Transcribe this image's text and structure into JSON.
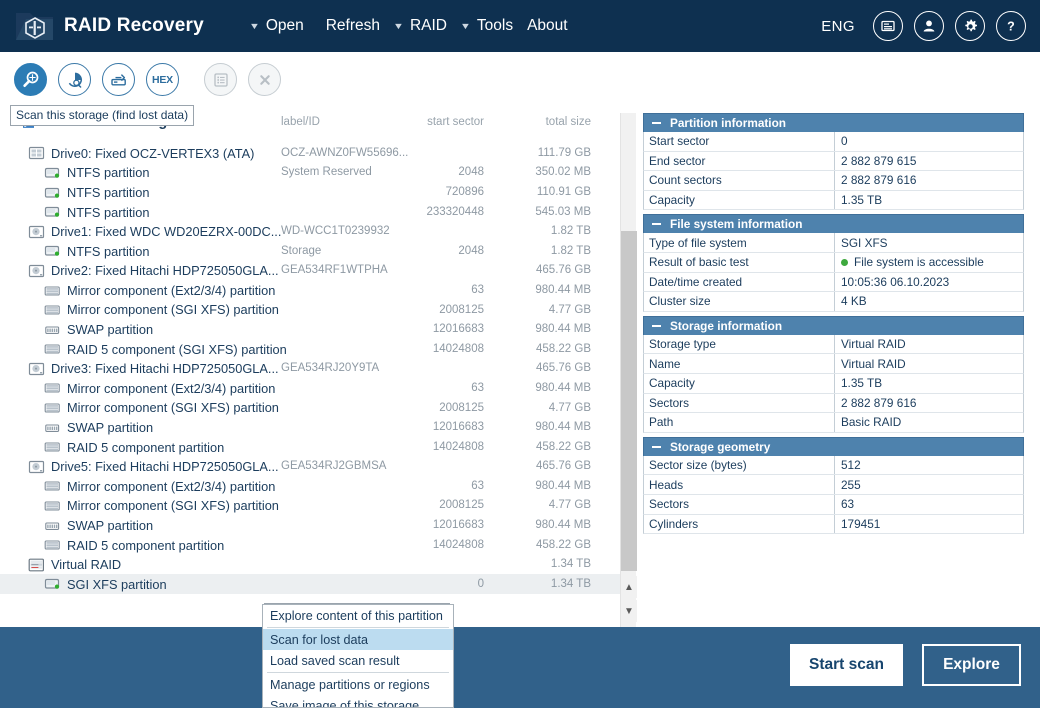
{
  "header": {
    "app_title": "RAID Recovery",
    "logo_icon": "raid-folder-logo",
    "menus": [
      {
        "label": "Open",
        "caret": "▼"
      },
      {
        "label": "Refresh",
        "caret": "▼"
      },
      {
        "label": "RAID",
        "caret": "▼"
      },
      {
        "label": "Tools",
        "caret": "▼"
      },
      {
        "label": "About",
        "caret": ""
      }
    ],
    "language": "ENG",
    "icons": [
      "news-icon",
      "user-icon",
      "gear-icon",
      "help-icon"
    ]
  },
  "toolbar": {
    "buttons": [
      {
        "name": "scan-this-storage",
        "icon": "magnifier-scan-icon",
        "state": "active"
      },
      {
        "name": "disk-analysis",
        "icon": "pie-disk-icon",
        "state": "normal"
      },
      {
        "name": "save-image",
        "icon": "disk-image-icon",
        "state": "normal"
      },
      {
        "name": "hex-viewer",
        "icon": "hex-icon",
        "state": "normal",
        "label": "HEX"
      },
      {
        "name": "list-view",
        "icon": "list-icon",
        "state": "disabled"
      },
      {
        "name": "close-view",
        "icon": "close-x-icon",
        "state": "disabled"
      }
    ],
    "tooltip": "Scan this storage (find lost data)"
  },
  "tree": {
    "title": "Connected storages",
    "title_icon": "connected-storages-icon",
    "columns": {
      "label": "label/ID",
      "start": "start sector",
      "total": "total size"
    },
    "rows": [
      {
        "kind": "drive",
        "icon": "ssd-icon",
        "name": "Drive0: Fixed OCZ-VERTEX3 (ATA)",
        "label": "OCZ-AWNZ0FW55696...",
        "start": "",
        "total": "111.79 GB"
      },
      {
        "kind": "part",
        "icon": "partition-icon",
        "name": "NTFS partition",
        "label": "System Reserved",
        "start": "2048",
        "total": "350.02 MB"
      },
      {
        "kind": "part",
        "icon": "partition-icon",
        "name": "NTFS partition",
        "label": "",
        "start": "720896",
        "total": "110.91 GB"
      },
      {
        "kind": "part",
        "icon": "partition-icon",
        "name": "NTFS partition",
        "label": "",
        "start": "233320448",
        "total": "545.03 MB"
      },
      {
        "kind": "drive",
        "icon": "hdd-icon",
        "name": "Drive1: Fixed WDC WD20EZRX-00DC...",
        "label": "WD-WCC1T0239932",
        "start": "",
        "total": "1.82 TB"
      },
      {
        "kind": "part",
        "icon": "partition-icon",
        "name": "NTFS partition",
        "label": "Storage",
        "start": "2048",
        "total": "1.82 TB"
      },
      {
        "kind": "drive",
        "icon": "hdd-icon",
        "name": "Drive2: Fixed Hitachi HDP725050GLA...",
        "label": "GEA534RF1WTPHA",
        "start": "",
        "total": "465.76 GB"
      },
      {
        "kind": "part",
        "icon": "raid-comp-icon",
        "name": "Mirror component (Ext2/3/4) partition",
        "label": "",
        "start": "63",
        "total": "980.44 MB"
      },
      {
        "kind": "part",
        "icon": "raid-comp-icon",
        "name": "Mirror component (SGI XFS) partition",
        "label": "",
        "start": "2008125",
        "total": "4.77 GB"
      },
      {
        "kind": "part",
        "icon": "swap-icon",
        "name": "SWAP partition",
        "label": "",
        "start": "12016683",
        "total": "980.44 MB"
      },
      {
        "kind": "part",
        "icon": "raid-comp-icon",
        "name": "RAID 5 component (SGI XFS) partition",
        "label": "",
        "start": "14024808",
        "total": "458.22 GB"
      },
      {
        "kind": "drive",
        "icon": "hdd-icon",
        "name": "Drive3: Fixed Hitachi HDP725050GLA...",
        "label": "GEA534RJ20Y9TA",
        "start": "",
        "total": "465.76 GB"
      },
      {
        "kind": "part",
        "icon": "raid-comp-icon",
        "name": "Mirror component (Ext2/3/4) partition",
        "label": "",
        "start": "63",
        "total": "980.44 MB"
      },
      {
        "kind": "part",
        "icon": "raid-comp-icon",
        "name": "Mirror component (SGI XFS) partition",
        "label": "",
        "start": "2008125",
        "total": "4.77 GB"
      },
      {
        "kind": "part",
        "icon": "swap-icon",
        "name": "SWAP partition",
        "label": "",
        "start": "12016683",
        "total": "980.44 MB"
      },
      {
        "kind": "part",
        "icon": "raid-comp-icon",
        "name": "RAID 5 component partition",
        "label": "",
        "start": "14024808",
        "total": "458.22 GB"
      },
      {
        "kind": "drive",
        "icon": "hdd-icon",
        "name": "Drive5: Fixed Hitachi HDP725050GLA...",
        "label": "GEA534RJ2GBMSA",
        "start": "",
        "total": "465.76 GB"
      },
      {
        "kind": "part",
        "icon": "raid-comp-icon",
        "name": "Mirror component (Ext2/3/4) partition",
        "label": "",
        "start": "63",
        "total": "980.44 MB"
      },
      {
        "kind": "part",
        "icon": "raid-comp-icon",
        "name": "Mirror component (SGI XFS) partition",
        "label": "",
        "start": "2008125",
        "total": "4.77 GB"
      },
      {
        "kind": "part",
        "icon": "swap-icon",
        "name": "SWAP partition",
        "label": "",
        "start": "12016683",
        "total": "980.44 MB"
      },
      {
        "kind": "part",
        "icon": "raid-comp-icon",
        "name": "RAID 5 component partition",
        "label": "",
        "start": "14024808",
        "total": "458.22 GB"
      },
      {
        "kind": "vraid",
        "icon": "virtual-raid-icon",
        "name": "Virtual RAID",
        "label": "",
        "start": "",
        "total": "1.34 TB"
      },
      {
        "kind": "part",
        "icon": "partition-icon",
        "name": "SGI XFS partition",
        "label": "",
        "start": "0",
        "total": "1.34 TB",
        "selected": true
      }
    ],
    "tooltip": "Explore content of this partition"
  },
  "context_menu": {
    "items": [
      {
        "label": "Explore content of this partition",
        "highlighted": false,
        "sep_after": true
      },
      {
        "label": "Scan for lost data",
        "highlighted": true,
        "sep_after": false
      },
      {
        "label": "Load saved scan result",
        "highlighted": false,
        "sep_after": true
      },
      {
        "label": "Manage partitions or regions",
        "highlighted": false,
        "sep_after": false
      },
      {
        "label": "Save image of this storage",
        "highlighted": false,
        "sep_after": false
      }
    ]
  },
  "properties": {
    "sections": [
      {
        "title": "Partition information",
        "rows": [
          {
            "key": "Start sector",
            "value": "0"
          },
          {
            "key": "End sector",
            "value": "2 882 879 615"
          },
          {
            "key": "Count sectors",
            "value": "2 882 879 616"
          },
          {
            "key": "Capacity",
            "value": "1.35 TB"
          }
        ]
      },
      {
        "title": "File system information",
        "rows": [
          {
            "key": "Type of file system",
            "value": "SGI XFS"
          },
          {
            "key": "Result of basic test",
            "value": "File system is accessible",
            "status": "ok"
          },
          {
            "key": "Date/time created",
            "value": "10:05:36 06.10.2023"
          },
          {
            "key": "Cluster size",
            "value": "4 KB"
          }
        ]
      },
      {
        "title": "Storage information",
        "rows": [
          {
            "key": "Storage type",
            "value": "Virtual RAID"
          },
          {
            "key": "Name",
            "value": "Virtual RAID"
          },
          {
            "key": "Capacity",
            "value": "1.35 TB"
          },
          {
            "key": "Sectors",
            "value": "2 882 879 616"
          },
          {
            "key": "Path",
            "value": "Basic RAID"
          }
        ]
      },
      {
        "title": "Storage geometry",
        "rows": [
          {
            "key": "Sector size (bytes)",
            "value": "512"
          },
          {
            "key": "Heads",
            "value": "255"
          },
          {
            "key": "Sectors",
            "value": "63"
          },
          {
            "key": "Cylinders",
            "value": "179451"
          }
        ]
      }
    ]
  },
  "footer": {
    "start_scan": "Start scan",
    "explore": "Explore"
  },
  "colors": {
    "titlebar": "#0e3050",
    "footer": "#31618a",
    "section_header": "#4e82ad",
    "accent": "#2c7cb5",
    "status_ok": "#3ea93e",
    "menu_highlight": "#bcdcf0"
  }
}
